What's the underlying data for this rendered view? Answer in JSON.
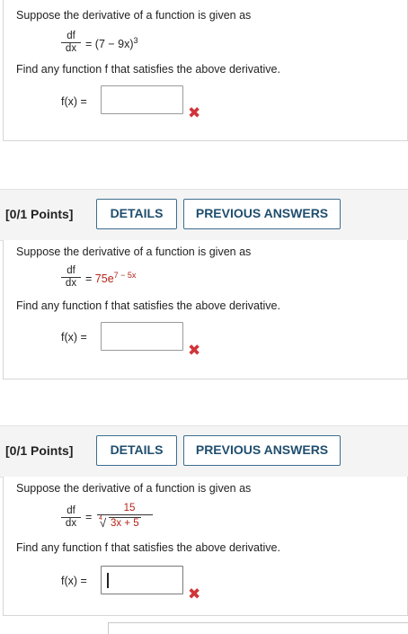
{
  "questions": [
    {
      "prompt": "Suppose the derivative of a function is given as",
      "frac_num": "df",
      "frac_den": "dx",
      "equals": "=",
      "rhs": "(7 − 9x)",
      "rhs_exp": "3",
      "instruction": "Find any function f that satisfies the above derivative.",
      "answer_label": "f(x) =",
      "answer_value": "",
      "status": "✖"
    },
    {
      "points": "[0/1 Points]",
      "details_label": "DETAILS",
      "previous_label": "PREVIOUS ANSWERS",
      "prompt": "Suppose the derivative of a function is given as",
      "frac_num": "df",
      "frac_den": "dx",
      "equals": "=",
      "rhs": "75e",
      "rhs_exp": "7 − 5x",
      "instruction": "Find any function f that satisfies the above derivative.",
      "answer_label": "f(x) =",
      "answer_value": "",
      "status": "✖"
    },
    {
      "points": "[0/1 Points]",
      "details_label": "DETAILS",
      "previous_label": "PREVIOUS ANSWERS",
      "prompt": "Suppose the derivative of a function is given as",
      "frac_num": "df",
      "frac_den": "dx",
      "equals": "=",
      "rhs_num": "15",
      "rhs_root_index": "4",
      "rhs_den": "3x + 5",
      "instruction": "Find any function f that satisfies the above derivative.",
      "answer_label": "f(x) =",
      "answer_value": "",
      "status": "✖"
    }
  ],
  "colors": {
    "accent": "#3c6e8f",
    "error": "#d0353a",
    "header_bg": "#f4f4f4"
  }
}
